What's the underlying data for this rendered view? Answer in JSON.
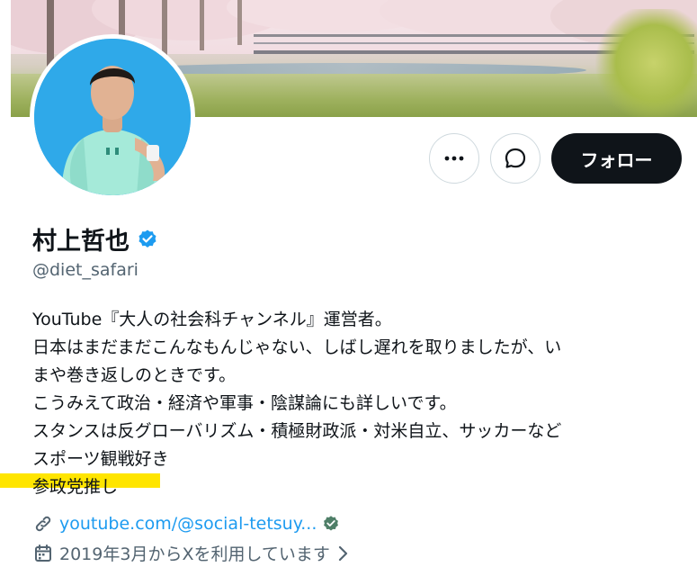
{
  "profile": {
    "display_name": "村上哲也",
    "verified_badge": "verified-badge-icon",
    "handle": "@diet_safari",
    "bio_lines": [
      "YouTube『大人の社会科チャンネル』運営者。",
      "日本はまだまだこんなもんじゃない、しばし遅れを取りましたが、い",
      "まや巻き返しのときです。",
      "こうみえて政治・経済や軍事・陰謀論にも詳しいです。",
      "スタンスは反グローバリズム・積極財政派・対米自立、サッカーなど",
      "スポーツ観戦好き",
      "参政党推し"
    ],
    "link": "youtube.com/@social-tetsuy...",
    "joined": "2019年3月からXを利用しています"
  },
  "actions": {
    "more_icon": "more-horizontal-icon",
    "message_icon": "message-icon",
    "follow_label": "フォロー"
  },
  "colors": {
    "accent": "#1d9bf0",
    "follow_button": "#0f1419",
    "secondary_text": "#536471",
    "highlight": "#ffe500",
    "avatar_background": "#2fa9e9"
  }
}
